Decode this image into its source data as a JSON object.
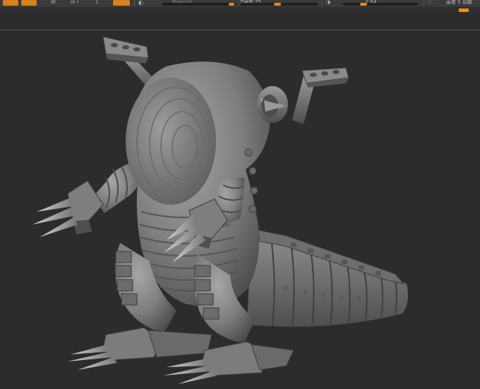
{
  "toolbar": {
    "btn_a": "",
    "btn_b": "",
    "item_1": "W",
    "item_2": "m r",
    "item_3": "L",
    "item_4": "",
    "field_1": "Rubicon",
    "field_2": "Z强度 25",
    "field_3": "",
    "field_4": "Y 64",
    "field_5": "画笔 S 调整"
  },
  "colors": {
    "accent": "#e28a22",
    "model": "#8c8c8c",
    "background": "#2c2c2c"
  }
}
